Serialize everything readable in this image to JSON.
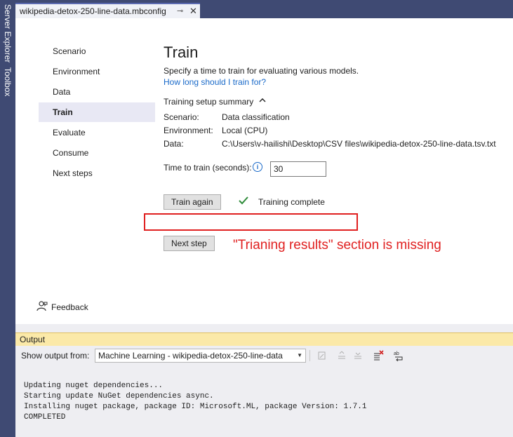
{
  "rail": {
    "server_explorer": "Server Explorer",
    "toolbox": "Toolbox"
  },
  "tab": {
    "title": "wikipedia-detox-250-line-data.mbconfig",
    "pin_icon": "pin-icon",
    "close_icon": "close-icon"
  },
  "nav": {
    "items": [
      "Scenario",
      "Environment",
      "Data",
      "Train",
      "Evaluate",
      "Consume",
      "Next steps"
    ],
    "active": "Train"
  },
  "main": {
    "title": "Train",
    "description": "Specify a time to train for evaluating various models.",
    "link": "How long should I train for?",
    "summary_header": "Training setup summary",
    "summary": {
      "scenario_label": "Scenario:",
      "scenario_value": "Data classification",
      "environment_label": "Environment:",
      "environment_value": "Local (CPU)",
      "data_label": "Data:",
      "data_value": "C:\\Users\\v-hailishi\\Desktop\\CSV files\\wikipedia-detox-250-line-data.tsv.txt"
    },
    "time_label": "Time to train (seconds):",
    "time_value": "30",
    "train_again": "Train again",
    "status": "Training complete",
    "next_step": "Next step"
  },
  "annotation": {
    "text": "\"Trianing results\" section is missing",
    "color": "#e02020"
  },
  "feedback": "Feedback",
  "output": {
    "title": "Output",
    "show_label": "Show output from:",
    "source": "Machine Learning - wikipedia-detox-250-line-data",
    "lines": [
      "Updating nuget dependencies...",
      "Starting update NuGet dependencies async.",
      "Installing nuget package, package ID: Microsoft.ML, package Version: 1.7.1",
      "COMPLETED"
    ]
  },
  "colors": {
    "rail": "#3f4a73",
    "output_header": "#fbe9a8",
    "link": "#1a6ac9",
    "success": "#2e8b3a"
  }
}
